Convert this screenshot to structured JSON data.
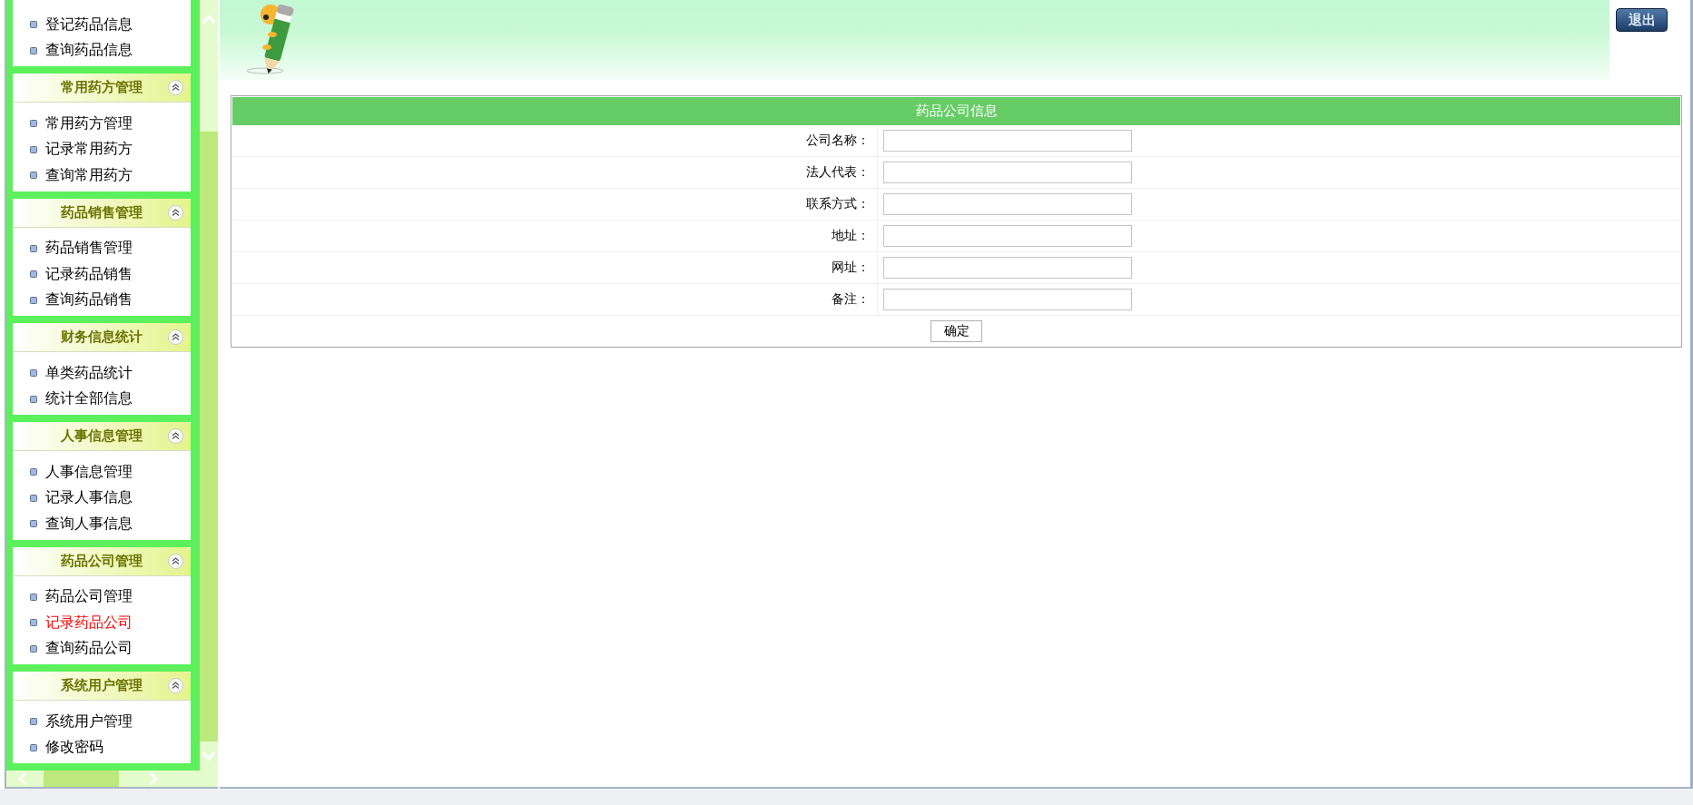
{
  "sidebar": {
    "groups": [
      {
        "items": [
          {
            "label": "登记药品信息",
            "selected": false
          },
          {
            "label": "查询药品信息",
            "selected": false
          }
        ]
      },
      {
        "title": "常用药方管理",
        "expanded": true,
        "items": [
          {
            "label": "常用药方管理",
            "selected": false
          },
          {
            "label": "记录常用药方",
            "selected": false
          },
          {
            "label": "查询常用药方",
            "selected": false
          }
        ]
      },
      {
        "title": "药品销售管理",
        "expanded": true,
        "items": [
          {
            "label": "药品销售管理",
            "selected": false
          },
          {
            "label": "记录药品销售",
            "selected": false
          },
          {
            "label": "查询药品销售",
            "selected": false
          }
        ]
      },
      {
        "title": "财务信息统计",
        "expanded": true,
        "items": [
          {
            "label": "单类药品统计",
            "selected": false
          },
          {
            "label": "统计全部信息",
            "selected": false
          }
        ]
      },
      {
        "title": "人事信息管理",
        "expanded": true,
        "items": [
          {
            "label": "人事信息管理",
            "selected": false
          },
          {
            "label": "记录人事信息",
            "selected": false
          },
          {
            "label": "查询人事信息",
            "selected": false
          }
        ]
      },
      {
        "title": "药品公司管理",
        "expanded": true,
        "items": [
          {
            "label": "药品公司管理",
            "selected": false
          },
          {
            "label": "记录药品公司",
            "selected": true
          },
          {
            "label": "查询药品公司",
            "selected": false
          }
        ]
      },
      {
        "title": "系统用户管理",
        "expanded": true,
        "items": [
          {
            "label": "系统用户管理",
            "selected": false
          },
          {
            "label": "修改密码",
            "selected": false
          }
        ]
      }
    ]
  },
  "header": {
    "logout": "退出"
  },
  "form": {
    "title": "药品公司信息",
    "fields": [
      {
        "label": "公司名称："
      },
      {
        "label": "法人代表："
      },
      {
        "label": "联系方式："
      },
      {
        "label": "地址："
      },
      {
        "label": "网址："
      },
      {
        "label": "备注："
      }
    ],
    "submit": "确定"
  }
}
